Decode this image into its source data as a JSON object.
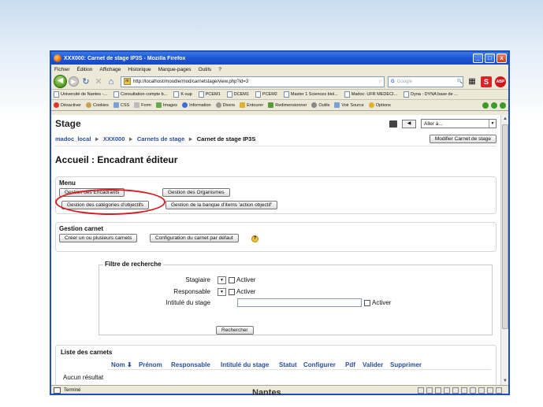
{
  "window": {
    "title": "XXX000: Carnet de stage IP3S - Mozilla Firefox",
    "controls": [
      "_",
      "□",
      "x"
    ]
  },
  "menubar": [
    "Fichier",
    "Édition",
    "Affichage",
    "Historique",
    "Marque-pages",
    "Outils",
    "?"
  ],
  "nav": {
    "url": "http://localhost/moodle/mod/carnetstage/view.php?id=3",
    "search_placeholder": "Google",
    "search_engine": "G"
  },
  "bookmarks": [
    "Université de Nantes -...",
    "Consultation compte b...",
    "K-sup",
    "PCEM1",
    "DCEM1",
    "PCEM2",
    "Master 1 Sciences biol...",
    "Madoc: UFR MEDECI...",
    "Dyna : DYNA base de ..."
  ],
  "devtoolbar": [
    "Désactiver",
    "Cookies",
    "CSS",
    "Form",
    "Images",
    "Information",
    "Divers",
    "Entourer",
    "Redimensionner",
    "Outils",
    "Voir Source",
    "Options"
  ],
  "page": {
    "site_title": "Stage",
    "jump_to": "Aller à...",
    "breadcrumb": [
      "madoc_local",
      "XXX000",
      "Carnets de stage",
      "Carnet de stage IP3S"
    ],
    "modify_button": "Modifier Carnet de stage",
    "heading": "Accueil : Encadrant éditeur"
  },
  "menu_box": {
    "title": "Menu",
    "buttons": [
      "Gestion des Encadrants",
      "Gestion des Organismes",
      "Gestion des catégories d'objectifs",
      "Gestion de la banque d'items 'action objectif'"
    ]
  },
  "carnet_box": {
    "title": "Gestion carnet",
    "buttons": [
      "Créer un ou plusieurs carnets",
      "Configuration du carnet par défaut"
    ]
  },
  "filter": {
    "legend": "Filtre de recherche",
    "fields": [
      {
        "label": "Stagiaire",
        "checkbox": "Activer"
      },
      {
        "label": "Responsable",
        "checkbox": "Activer"
      },
      {
        "label": "Intitulé du stage",
        "checkbox": "Activer"
      }
    ],
    "search_button": "Rechercher"
  },
  "list": {
    "title": "Liste des carnets",
    "columns": [
      "Nom ⬇",
      "Prénom",
      "Responsable",
      "Intitulé du stage",
      "Statut",
      "Configurer",
      "Pdf",
      "Valider",
      "Supprimer"
    ],
    "empty_text": "Aucun résultat"
  },
  "status": {
    "text": "Terminé"
  },
  "slide_footer": "Nantes",
  "colors": {
    "titlebar": "#1e56d6",
    "link": "#2b4d9c",
    "highlight_oval": "#d8191e"
  }
}
